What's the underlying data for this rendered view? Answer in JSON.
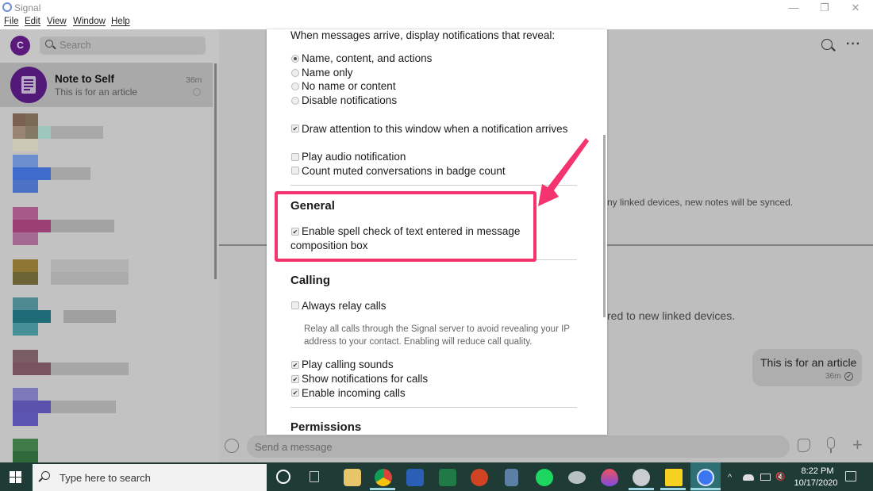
{
  "window": {
    "app_title": "Signal",
    "controls": {
      "minimize": "—",
      "restore": "❐",
      "close": "✕"
    }
  },
  "menu": [
    "File",
    "Edit",
    "View",
    "Window",
    "Help"
  ],
  "sidebar": {
    "avatar_initial": "C",
    "search_placeholder": "Search",
    "conversations": [
      {
        "title": "Note to Self",
        "preview": "This is for an article",
        "time": "36m",
        "icon": "note-document-icon"
      }
    ]
  },
  "conversation": {
    "header_icons": [
      "search-icon",
      "more-options-icon"
    ],
    "more_label": "···",
    "info_text_1": "ny linked devices, new notes will be synced.",
    "info_text_2": "red to new linked devices.",
    "message": {
      "text": "This is for an article",
      "time": "36m",
      "status": "sent-check-icon"
    },
    "composer_placeholder": "Send a message",
    "composer_icons": [
      "emoji-icon",
      "sticker-icon",
      "microphone-icon",
      "attach-plus-icon"
    ],
    "plus_label": "+"
  },
  "settings": {
    "notification_intro": "When messages arrive, display notifications that reveal:",
    "notification_options": [
      {
        "label": "Name, content, and actions",
        "selected": true
      },
      {
        "label": "Name only",
        "selected": false
      },
      {
        "label": "No name or content",
        "selected": false
      },
      {
        "label": "Disable notifications",
        "selected": false
      }
    ],
    "draw_attention": {
      "label": "Draw attention to this window when a notification arrives",
      "checked": true
    },
    "audio": [
      {
        "label": "Play audio notification",
        "checked": false
      },
      {
        "label": "Count muted conversations in badge count",
        "checked": false
      }
    ],
    "general": {
      "heading": "General",
      "spell_check_line1": "Enable spell check of text entered in message",
      "spell_check_line2": "composition box",
      "spell_check_checked": true
    },
    "calling": {
      "heading": "Calling",
      "always_relay": {
        "label": "Always relay calls",
        "checked": false
      },
      "relay_desc_line1": "Relay all calls through the Signal server to avoid revealing your IP",
      "relay_desc_line2": "address to your contact. Enabling will reduce call quality.",
      "options": [
        {
          "label": "Play calling sounds",
          "checked": true
        },
        {
          "label": "Show notifications for calls",
          "checked": true
        },
        {
          "label": "Enable incoming calls",
          "checked": true
        }
      ]
    },
    "permissions_heading": "Permissions",
    "check_glyph": "✔",
    "annotation_color": "#f4336f"
  },
  "taskbar": {
    "search_placeholder": "Type here to search",
    "apps": [
      "cortana",
      "task-view",
      "file-explorer",
      "chrome",
      "word",
      "excel",
      "powerpoint",
      "calculator",
      "spotify",
      "app-generic",
      "paint-3d",
      "paint",
      "sticky-notes",
      "signal"
    ],
    "tray_chevron": "^",
    "volume_label": "🔇",
    "time": "8:22 PM",
    "date": "10/17/2020"
  }
}
